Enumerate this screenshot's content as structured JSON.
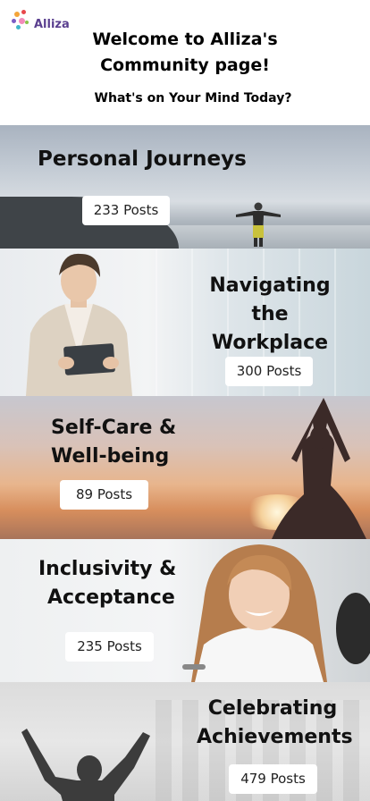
{
  "header": {
    "logo_text": "Alliza",
    "welcome_line1": "Welcome to Alliza's",
    "welcome_line2": "Community page!",
    "subtitle": "What's on Your Mind Today?"
  },
  "categories": [
    {
      "title_line1": "Personal Journeys",
      "title_line2": "",
      "posts": "233 Posts"
    },
    {
      "title_line1": "Navigating the",
      "title_line2": "Workplace",
      "posts": "300 Posts"
    },
    {
      "title_line1": "Self-Care &",
      "title_line2": "Well-being",
      "posts": "89 Posts"
    },
    {
      "title_line1": "Inclusivity &",
      "title_line2": "Acceptance",
      "posts": "235 Posts"
    },
    {
      "title_line1": "Celebrating",
      "title_line2": "Achievements",
      "posts": "479 Posts"
    }
  ],
  "colors": {
    "logo_text": "#5a3f8f",
    "logo_dots": [
      "#e8474c",
      "#f4a53a",
      "#7b5cc4",
      "#3fb6c9",
      "#8bc34a",
      "#f06ea9"
    ]
  }
}
